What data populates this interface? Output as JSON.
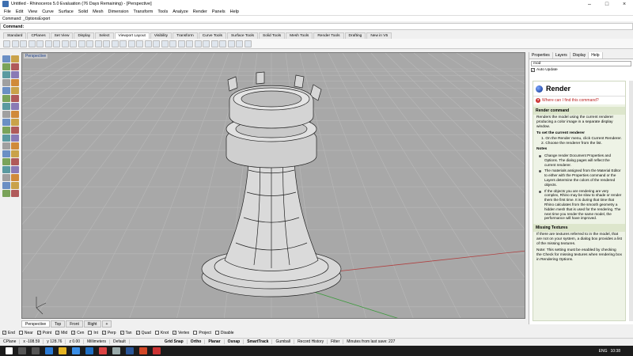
{
  "window": {
    "title": "Untitled - Rhinoceros 5.0 Evaluation (76 Days Remaining) - [Perspective]"
  },
  "menu": [
    "File",
    "Edit",
    "View",
    "Curve",
    "Surface",
    "Solid",
    "Mesh",
    "Dimension",
    "Transform",
    "Tools",
    "Analyze",
    "Render",
    "Panels",
    "Help"
  ],
  "command": {
    "history": "Command: _OptionsExport",
    "prompt": "Command:"
  },
  "toolbar_tabs": [
    {
      "label": "Standard",
      "active": false
    },
    {
      "label": "CPlanes",
      "active": false
    },
    {
      "label": "Set View",
      "active": false
    },
    {
      "label": "Display",
      "active": false
    },
    {
      "label": "Select",
      "active": false
    },
    {
      "label": "Viewport Layout",
      "active": true
    },
    {
      "label": "Visibility",
      "active": false
    },
    {
      "label": "Transform",
      "active": false
    },
    {
      "label": "Curve Tools",
      "active": false
    },
    {
      "label": "Surface Tools",
      "active": false
    },
    {
      "label": "Solid Tools",
      "active": false
    },
    {
      "label": "Mesh Tools",
      "active": false
    },
    {
      "label": "Render Tools",
      "active": false
    },
    {
      "label": "Drafting",
      "active": false
    },
    {
      "label": "New in V5",
      "active": false
    }
  ],
  "viewport": {
    "label": "Perspective"
  },
  "viewport_tabs": [
    {
      "label": "Perspective",
      "active": true
    },
    {
      "label": "Top",
      "active": false
    },
    {
      "label": "Front",
      "active": false
    },
    {
      "label": "Right",
      "active": false
    },
    {
      "label": "+",
      "active": false
    }
  ],
  "osnaps": [
    {
      "label": "End",
      "checked": true
    },
    {
      "label": "Near",
      "checked": false
    },
    {
      "label": "Point",
      "checked": true
    },
    {
      "label": "Mid",
      "checked": true
    },
    {
      "label": "Cen",
      "checked": true
    },
    {
      "label": "Int",
      "checked": false
    },
    {
      "label": "Perp",
      "checked": true
    },
    {
      "label": "Tan",
      "checked": true
    },
    {
      "label": "Quad",
      "checked": true
    },
    {
      "label": "Knot",
      "checked": false
    },
    {
      "label": "Vertex",
      "checked": true
    },
    {
      "label": "Project",
      "checked": false
    },
    {
      "label": "Disable",
      "checked": false
    }
  ],
  "status": {
    "cplane": "CPlane",
    "x": "x -108.59",
    "y": "y 128.76",
    "z": "z 0.00",
    "units": "Millimeters",
    "layer": "Default",
    "modes": [
      "Grid Snap",
      "Ortho",
      "Planar",
      "Osnap",
      "SmartTrack",
      "Gumball",
      "Record History",
      "Filter"
    ],
    "message": "Minutes from last save: 227"
  },
  "panel": {
    "tabs": [
      {
        "label": "Properties",
        "active": false
      },
      {
        "label": "Layers",
        "active": false
      },
      {
        "label": "Display",
        "active": false
      },
      {
        "label": "Help",
        "active": true
      }
    ],
    "search": "mod",
    "auto_update": "Auto Update",
    "help": {
      "title": "Render",
      "where": "Where can I find this command?",
      "sections": [
        {
          "heading": "Render command",
          "body": "Renders the model using the current renderer producing a color image in a separate display window."
        },
        {
          "heading": "To set the current renderer",
          "steps": [
            "On the Render menu, click Current Renderer.",
            "Choose the renderer from the list."
          ]
        },
        {
          "heading": "Notes",
          "bullets": [
            "Change render Document Properties and Options. The dialog pages will reflect the current renderer.",
            "The materials assigned from the Material Editor to either with the Properties command or the Layers determine the colors of the rendered objects.",
            "If the objects you are rendering are very complex, Rhino may be slow to shade or render them the first time. It is during that time that Rhino calculates from the smooth geometry a hidden mesh that is used for the rendering. The next time you render the same model, the performance will have improved."
          ]
        },
        {
          "heading": "Missing Textures",
          "body": "If there are textures referred to in the model, that are not on your system, a dialog box provides a list of the missing textures.",
          "note": "Note: This setting must be enabled by checking the Check for missing textures when rendering box in Rendering Options."
        }
      ]
    }
  },
  "taskbar": {
    "time": "10:38",
    "lang": "ENG"
  },
  "colors": {
    "accent": "#1a3e8c",
    "viewport_bg": "#a8a8a8",
    "help_bg": "#eef3e6"
  }
}
